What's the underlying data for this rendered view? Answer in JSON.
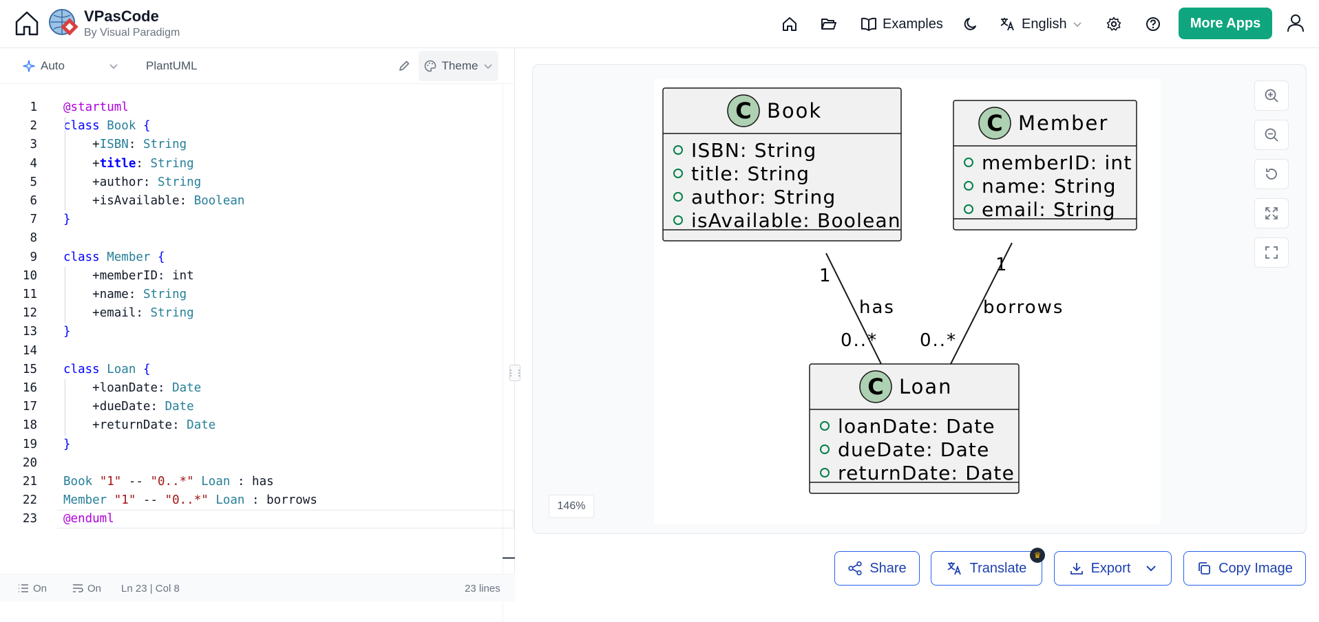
{
  "header": {
    "brand_name": "VPasCode",
    "brand_sub": "By Visual Paradigm",
    "examples_label": "Examples",
    "language_label": "English",
    "more_apps_label": "More Apps"
  },
  "editor": {
    "mode_label": "Auto",
    "language_label": "PlantUML",
    "theme_label": "Theme",
    "code_lines": [
      "@startuml",
      "class Book {",
      "    +ISBN: String",
      "    +title: String",
      "    +author: String",
      "    +isAvailable: Boolean",
      "}",
      "",
      "class Member {",
      "    +memberID: int",
      "    +name: String",
      "    +email: String",
      "}",
      "",
      "class Loan {",
      "    +loanDate: Date",
      "    +dueDate: Date",
      "    +returnDate: Date",
      "}",
      "",
      "Book \"1\" -- \"0..*\" Loan : has",
      "Member \"1\" -- \"0..*\" Loan : borrows",
      "@enduml"
    ],
    "status": {
      "wrap_label": "On",
      "format_label": "On",
      "cursor": "Ln 23 | Col 8",
      "line_count": "23 lines"
    }
  },
  "preview": {
    "zoom_level": "146%",
    "diagram": {
      "classes": [
        {
          "name": "Book",
          "icon_letter": "C",
          "attributes": [
            "ISBN: String",
            "title: String",
            "author: String",
            "isAvailable: Boolean"
          ]
        },
        {
          "name": "Member",
          "icon_letter": "C",
          "attributes": [
            "memberID: int",
            "name: String",
            "email: String"
          ]
        },
        {
          "name": "Loan",
          "icon_letter": "C",
          "attributes": [
            "loanDate: Date",
            "dueDate: Date",
            "returnDate: Date"
          ]
        }
      ],
      "associations": [
        {
          "from": "Book",
          "to": "Loan",
          "label": "has",
          "from_mult": "1",
          "to_mult": "0..*"
        },
        {
          "from": "Member",
          "to": "Loan",
          "label": "borrows",
          "from_mult": "1",
          "to_mult": "0..*"
        }
      ]
    }
  },
  "actions": {
    "share_label": "Share",
    "translate_label": "Translate",
    "export_label": "Export",
    "copy_image_label": "Copy Image"
  },
  "colors": {
    "accent": "#0fa67f",
    "action_blue": "#2563eb",
    "class_header": "#f1f1f1",
    "class_icon": "#add1b2"
  }
}
